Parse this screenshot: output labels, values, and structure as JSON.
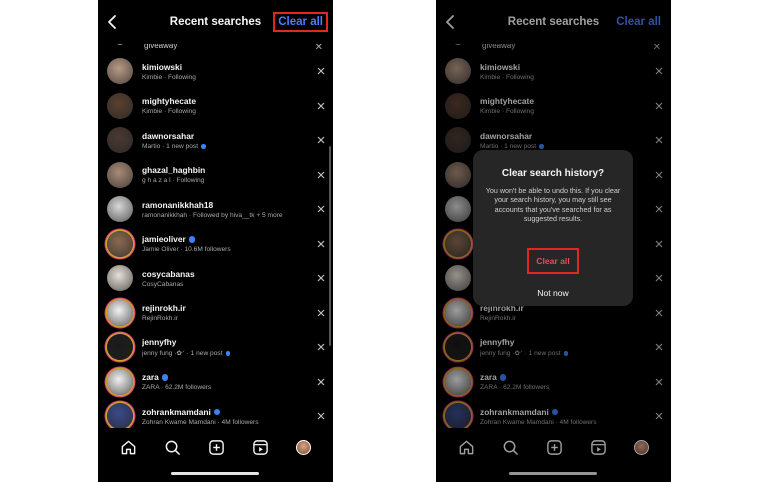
{
  "header": {
    "title": "Recent searches",
    "clear_all_label": "Clear all"
  },
  "partial_row": {
    "text": "giveaway"
  },
  "rows": [
    {
      "username": "kimiowski",
      "subtitle": "Kimbie · Following",
      "verified": false,
      "dot": false,
      "story": false,
      "avatar_color": "#b89a86"
    },
    {
      "username": "mightyhecate",
      "subtitle": "Kimbie · Following",
      "verified": false,
      "dot": false,
      "story": false,
      "avatar_color": "#5a4030"
    },
    {
      "username": "dawnorsahar",
      "subtitle": "Martio · 1 new post",
      "verified": false,
      "dot": true,
      "story": false,
      "avatar_color": "#4a3a32"
    },
    {
      "username": "ghazal_haghbin",
      "subtitle": "g h a z a l · Following",
      "verified": false,
      "dot": false,
      "story": false,
      "avatar_color": "#a88a76"
    },
    {
      "username": "ramonanikkhah18",
      "subtitle": "ramonanikkhah · Followed by hiva__tk + 5 more",
      "verified": false,
      "dot": false,
      "story": false,
      "avatar_color": "#d8d8d8"
    },
    {
      "username": "jamieoliver",
      "subtitle": "Jamie Oliver · 10.6M followers",
      "verified": true,
      "dot": false,
      "story": true,
      "avatar_color": "#8a6a52"
    },
    {
      "username": "cosycabanas",
      "subtitle": "CosyCabanas",
      "verified": false,
      "dot": false,
      "story": false,
      "avatar_color": "#e6e0d6"
    },
    {
      "username": "rejinrokh.ir",
      "subtitle": "RejinRokh.ir",
      "verified": false,
      "dot": false,
      "story": true,
      "avatar_color": "#f2f2f2"
    },
    {
      "username": "jennyfhy",
      "subtitle": "jenny fung ·✿ᐟ · 1 new post",
      "verified": false,
      "dot": true,
      "story": true,
      "avatar_color": "#1a1a1a"
    },
    {
      "username": "zara",
      "subtitle": "ZARA · 62.2M followers",
      "verified": true,
      "dot": false,
      "story": true,
      "avatar_color": "#f0f0f0"
    },
    {
      "username": "zohrankmamdani",
      "subtitle": "Zohran Kwame Mamdani · 4M followers",
      "verified": true,
      "dot": false,
      "story": true,
      "avatar_color": "#3a4a8a"
    }
  ],
  "dialog": {
    "title": "Clear search history?",
    "body": "You won't be able to undo this. If you clear your search history, you may still see accounts that you've searched for as suggested results.",
    "clear_label": "Clear all",
    "not_now_label": "Not now"
  },
  "nav": {
    "icons": [
      "home-icon",
      "search-icon",
      "create-icon",
      "reels-icon",
      "profile-avatar"
    ]
  },
  "colors": {
    "accent": "#4a7dff",
    "highlight": "#e0281f",
    "destructive": "#ed4956",
    "background": "#000000",
    "dialog": "#262626"
  }
}
